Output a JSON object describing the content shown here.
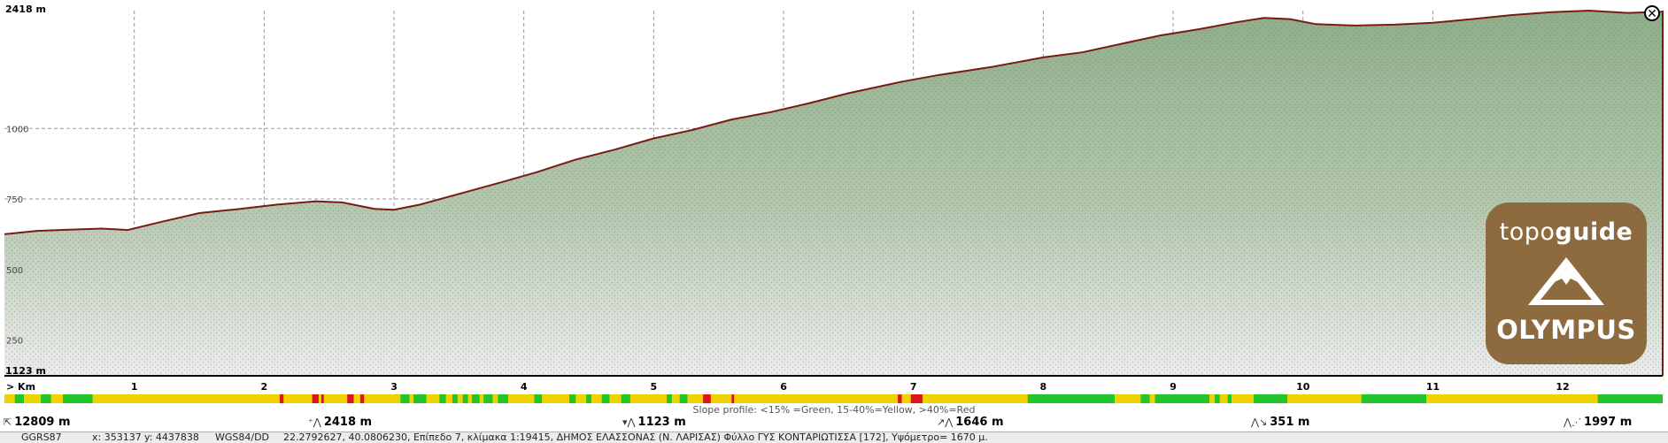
{
  "chart_data": {
    "type": "area",
    "title": "",
    "xlabel": "Km",
    "ylabel": "",
    "x_unit_label": "> Km",
    "xlim": [
      0,
      12.77
    ],
    "ylim": [
      1123,
      2418
    ],
    "y_top_label": "2418 m",
    "y_bottom_label": "1123 m",
    "y_ticks": [
      1250,
      1500,
      1750,
      2000
    ],
    "y_tick_labels": [
      "250",
      "500",
      "750",
      "1000"
    ],
    "x_ticks": [
      1,
      2,
      3,
      4,
      5,
      6,
      7,
      8,
      9,
      10,
      11,
      12
    ],
    "x_tick_labels": [
      "1",
      "2",
      "3",
      "4",
      "5",
      "6",
      "7",
      "8",
      "9",
      "10",
      "11",
      "12"
    ],
    "grid": true,
    "series": [
      {
        "x": [
          0,
          0.25,
          0.5,
          0.75,
          0.95,
          1.2,
          1.5,
          1.8,
          2.1,
          2.4,
          2.6,
          2.85,
          3.0,
          3.2,
          3.5,
          3.8,
          4.1,
          4.4,
          4.7,
          5.0,
          5.3,
          5.6,
          5.9,
          6.2,
          6.5,
          6.9,
          7.2,
          7.6,
          8.0,
          8.3,
          8.6,
          8.9,
          9.2,
          9.5,
          9.7,
          9.9,
          10.1,
          10.4,
          10.7,
          11.0,
          11.3,
          11.6,
          11.9,
          12.2,
          12.5,
          12.77
        ],
        "y": [
          1625,
          1637,
          1641,
          1645,
          1640,
          1668,
          1700,
          1714,
          1730,
          1742,
          1738,
          1715,
          1712,
          1730,
          1768,
          1806,
          1845,
          1890,
          1925,
          1965,
          1995,
          2032,
          2058,
          2090,
          2125,
          2165,
          2190,
          2218,
          2252,
          2270,
          2300,
          2330,
          2352,
          2378,
          2392,
          2388,
          2370,
          2365,
          2368,
          2375,
          2388,
          2402,
          2412,
          2418,
          2410,
          2414
        ]
      }
    ],
    "slope_profile_caption": "Slope profile: <15% =Green, 15-40%=Yellow, >40%=Red",
    "slope_segments": [
      {
        "from": 0,
        "to": 0.08,
        "c": "yellow"
      },
      {
        "from": 0.08,
        "to": 0.15,
        "c": "green"
      },
      {
        "from": 0.15,
        "to": 0.28,
        "c": "yellow"
      },
      {
        "from": 0.28,
        "to": 0.36,
        "c": "green"
      },
      {
        "from": 0.36,
        "to": 0.45,
        "c": "yellow"
      },
      {
        "from": 0.45,
        "to": 0.68,
        "c": "green"
      },
      {
        "from": 0.68,
        "to": 2.12,
        "c": "yellow"
      },
      {
        "from": 2.12,
        "to": 2.15,
        "c": "red"
      },
      {
        "from": 2.15,
        "to": 2.37,
        "c": "yellow"
      },
      {
        "from": 2.37,
        "to": 2.42,
        "c": "red"
      },
      {
        "from": 2.42,
        "to": 2.44,
        "c": "yellow"
      },
      {
        "from": 2.44,
        "to": 2.46,
        "c": "red"
      },
      {
        "from": 2.46,
        "to": 2.64,
        "c": "yellow"
      },
      {
        "from": 2.64,
        "to": 2.69,
        "c": "red"
      },
      {
        "from": 2.69,
        "to": 2.74,
        "c": "yellow"
      },
      {
        "from": 2.74,
        "to": 2.77,
        "c": "red"
      },
      {
        "from": 2.77,
        "to": 3.05,
        "c": "yellow"
      },
      {
        "from": 3.05,
        "to": 3.12,
        "c": "green"
      },
      {
        "from": 3.12,
        "to": 3.15,
        "c": "yellow"
      },
      {
        "from": 3.15,
        "to": 3.25,
        "c": "green"
      },
      {
        "from": 3.25,
        "to": 3.35,
        "c": "yellow"
      },
      {
        "from": 3.35,
        "to": 3.4,
        "c": "green"
      },
      {
        "from": 3.4,
        "to": 3.45,
        "c": "yellow"
      },
      {
        "from": 3.45,
        "to": 3.49,
        "c": "green"
      },
      {
        "from": 3.49,
        "to": 3.53,
        "c": "yellow"
      },
      {
        "from": 3.53,
        "to": 3.57,
        "c": "green"
      },
      {
        "from": 3.57,
        "to": 3.6,
        "c": "yellow"
      },
      {
        "from": 3.6,
        "to": 3.66,
        "c": "green"
      },
      {
        "from": 3.66,
        "to": 3.69,
        "c": "yellow"
      },
      {
        "from": 3.69,
        "to": 3.76,
        "c": "green"
      },
      {
        "from": 3.76,
        "to": 3.8,
        "c": "yellow"
      },
      {
        "from": 3.8,
        "to": 3.88,
        "c": "green"
      },
      {
        "from": 3.88,
        "to": 4.08,
        "c": "yellow"
      },
      {
        "from": 4.08,
        "to": 4.14,
        "c": "green"
      },
      {
        "from": 4.14,
        "to": 4.35,
        "c": "yellow"
      },
      {
        "from": 4.35,
        "to": 4.4,
        "c": "green"
      },
      {
        "from": 4.4,
        "to": 4.48,
        "c": "yellow"
      },
      {
        "from": 4.48,
        "to": 4.52,
        "c": "green"
      },
      {
        "from": 4.52,
        "to": 4.6,
        "c": "yellow"
      },
      {
        "from": 4.6,
        "to": 4.66,
        "c": "green"
      },
      {
        "from": 4.66,
        "to": 4.75,
        "c": "yellow"
      },
      {
        "from": 4.75,
        "to": 4.82,
        "c": "green"
      },
      {
        "from": 4.82,
        "to": 5.1,
        "c": "yellow"
      },
      {
        "from": 5.1,
        "to": 5.14,
        "c": "green"
      },
      {
        "from": 5.14,
        "to": 5.2,
        "c": "yellow"
      },
      {
        "from": 5.2,
        "to": 5.26,
        "c": "green"
      },
      {
        "from": 5.26,
        "to": 5.38,
        "c": "yellow"
      },
      {
        "from": 5.38,
        "to": 5.44,
        "c": "red"
      },
      {
        "from": 5.44,
        "to": 5.6,
        "c": "yellow"
      },
      {
        "from": 5.6,
        "to": 5.62,
        "c": "red"
      },
      {
        "from": 5.62,
        "to": 6.88,
        "c": "yellow"
      },
      {
        "from": 6.88,
        "to": 6.91,
        "c": "red"
      },
      {
        "from": 6.91,
        "to": 6.98,
        "c": "yellow"
      },
      {
        "from": 6.98,
        "to": 7.07,
        "c": "red"
      },
      {
        "from": 7.07,
        "to": 7.88,
        "c": "yellow"
      },
      {
        "from": 7.88,
        "to": 8.55,
        "c": "green"
      },
      {
        "from": 8.55,
        "to": 8.75,
        "c": "yellow"
      },
      {
        "from": 8.75,
        "to": 8.82,
        "c": "green"
      },
      {
        "from": 8.82,
        "to": 8.86,
        "c": "yellow"
      },
      {
        "from": 8.86,
        "to": 9.28,
        "c": "green"
      },
      {
        "from": 9.28,
        "to": 9.32,
        "c": "yellow"
      },
      {
        "from": 9.32,
        "to": 9.36,
        "c": "green"
      },
      {
        "from": 9.36,
        "to": 9.42,
        "c": "yellow"
      },
      {
        "from": 9.42,
        "to": 9.45,
        "c": "green"
      },
      {
        "from": 9.45,
        "to": 9.62,
        "c": "yellow"
      },
      {
        "from": 9.62,
        "to": 9.88,
        "c": "green"
      },
      {
        "from": 9.88,
        "to": 10.45,
        "c": "yellow"
      },
      {
        "from": 10.45,
        "to": 10.95,
        "c": "green"
      },
      {
        "from": 10.95,
        "to": 12.27,
        "c": "yellow"
      },
      {
        "from": 12.27,
        "to": 12.77,
        "c": "green"
      }
    ]
  },
  "stats": {
    "total_distance": "12809 m",
    "max_elevation": "2418 m",
    "min_elevation": "1123 m",
    "ascent": "1646 m",
    "descent": "351 m",
    "last": "1997 m"
  },
  "statusbar": {
    "datum": "GGRS87",
    "x": "x: 353137",
    "y": "y: 4437838",
    "wgs_label": "WGS84/DD",
    "coords_info": "22.2792627, 40.0806230, Επίπεδο 7, κλίμακα 1:19415, ΔΗΜΟΣ ΕΛΑΣΣΟΝΑΣ (Ν. ΛΑΡΙΣΑΣ) Φύλλο ΓΥΣ ΚΟΝΤΑΡΙΩΤΙΣΣΑ [172], Υψόμετρο= 1670 μ."
  },
  "logo": {
    "brand_light": "topo",
    "brand_bold": "guide",
    "place": "OLYMPUS"
  },
  "icons": {
    "close": "close-icon",
    "distance": "distance-icon",
    "max": "max-elevation-icon",
    "min": "min-elevation-icon",
    "ascent": "ascent-icon",
    "descent": "descent-icon"
  },
  "colors": {
    "profile_line": "#7a1b12",
    "terrain_top": "#8fae8a",
    "terrain_bottom": "#ececec",
    "slope_green": "#22c52c",
    "slope_yellow": "#f0d200",
    "slope_red": "#e0141c",
    "logo_brown": "#8e6a3f"
  }
}
